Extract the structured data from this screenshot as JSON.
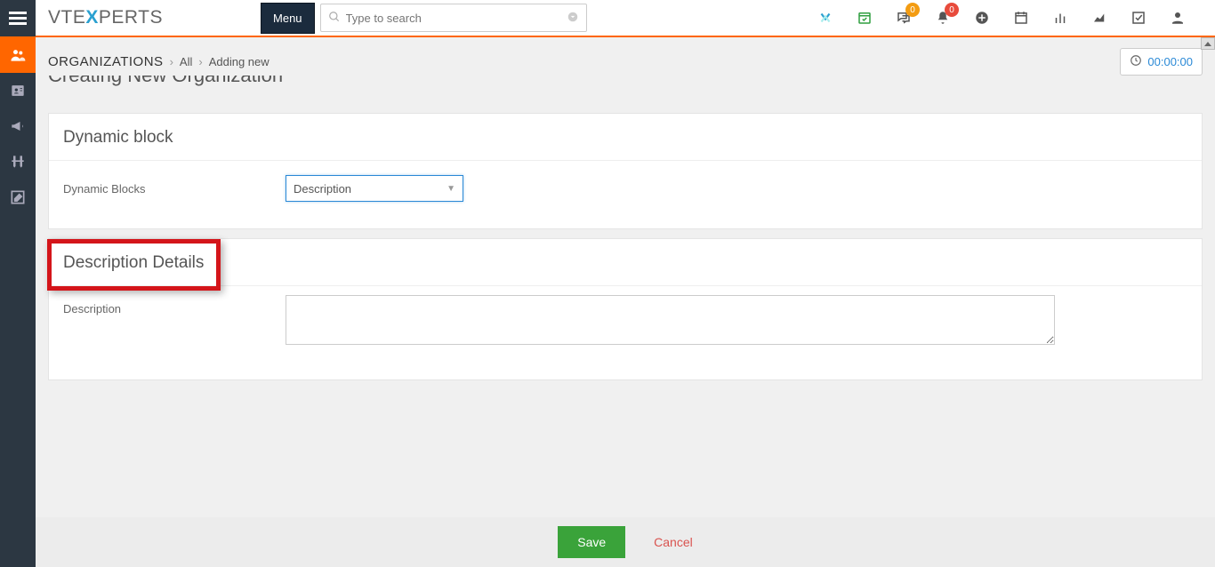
{
  "header": {
    "logo_parts": {
      "pre": "VT",
      "e1": "E",
      "x": "X",
      "rest": "PERTS"
    },
    "menu_label": "Menu",
    "search_placeholder": "Type to search",
    "badges": {
      "chat": "0",
      "bell": "0"
    }
  },
  "breadcrumb": {
    "root": "ORGANIZATIONS",
    "level1": "All",
    "level2": "Adding new"
  },
  "timer": "00:00:00",
  "page_title_partial": "Creating New Organization",
  "block1": {
    "title": "Dynamic block",
    "field_label": "Dynamic Blocks",
    "select_value": "Description"
  },
  "block2": {
    "title": "Description Details",
    "field_label": "Description",
    "textarea_value": ""
  },
  "footer": {
    "save": "Save",
    "cancel": "Cancel"
  }
}
